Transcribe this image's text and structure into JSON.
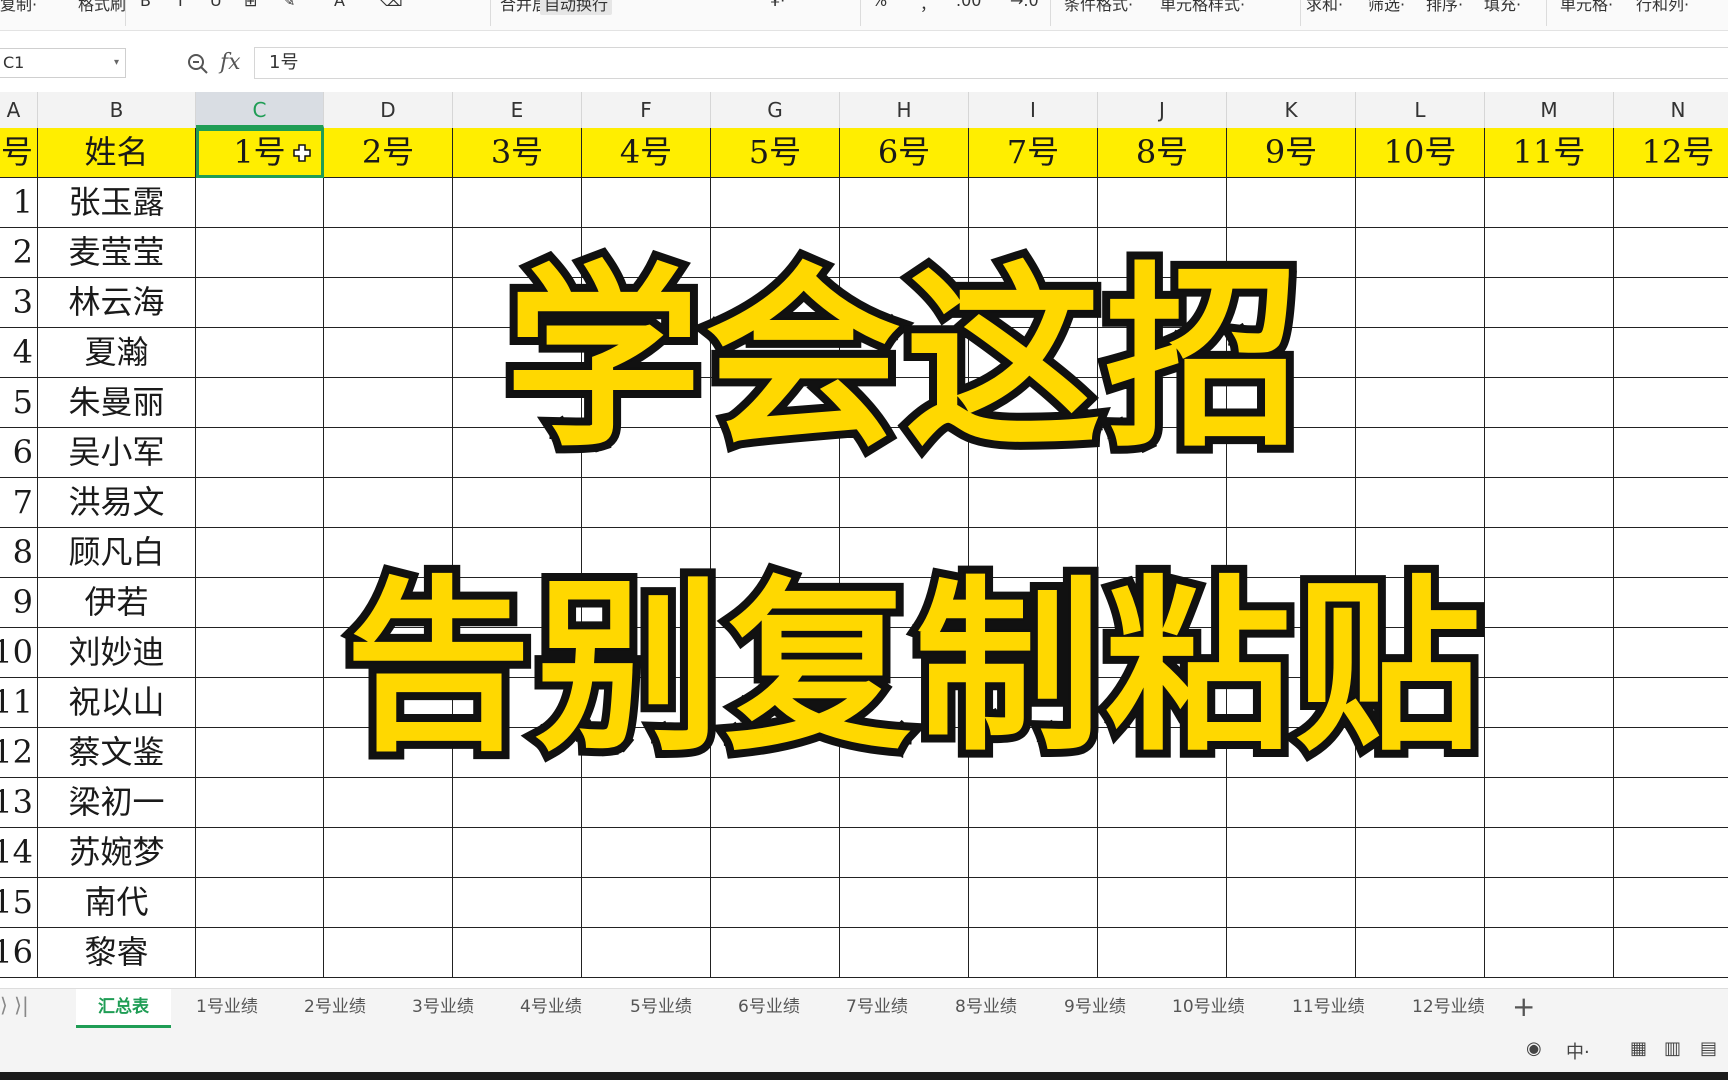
{
  "ribbon": {
    "items": [
      "复制·",
      "格式刷",
      "B",
      "I",
      "U",
      "⊞",
      "✎",
      "A",
      "⌫",
      "合并居中·",
      "自动换行",
      "¥·",
      "%",
      "，",
      ".00",
      "→.0",
      "条件格式·",
      "单元格样式·",
      "求和·",
      "筛选·",
      "排序·",
      "填充·",
      "单元格·",
      "行和列·"
    ]
  },
  "formula_bar": {
    "name_box": "C1",
    "fx_label": "fx",
    "formula_value": "1号"
  },
  "columns": [
    "A",
    "B",
    "C",
    "D",
    "E",
    "F",
    "G",
    "H",
    "I",
    "J",
    "K",
    "L",
    "M",
    "N"
  ],
  "selected_column": "C",
  "header_row": [
    "号",
    "姓名",
    "1号",
    "2号",
    "3号",
    "4号",
    "5号",
    "6号",
    "7号",
    "8号",
    "9号",
    "10号",
    "11号",
    "12号"
  ],
  "rows": [
    {
      "num": "1",
      "name": "张玉露"
    },
    {
      "num": "2",
      "name": "麦莹莹"
    },
    {
      "num": "3",
      "name": "林云海"
    },
    {
      "num": "4",
      "name": "夏瀚"
    },
    {
      "num": "5",
      "name": "朱曼丽"
    },
    {
      "num": "6",
      "name": "吴小军"
    },
    {
      "num": "7",
      "name": "洪易文"
    },
    {
      "num": "8",
      "name": "顾凡白"
    },
    {
      "num": "9",
      "name": "伊若"
    },
    {
      "num": "10",
      "name": "刘妙迪"
    },
    {
      "num": "11",
      "name": "祝以山"
    },
    {
      "num": "12",
      "name": "蔡文鉴"
    },
    {
      "num": "13",
      "name": "梁初一"
    },
    {
      "num": "14",
      "name": "苏婉梦"
    },
    {
      "num": "15",
      "name": "南代"
    },
    {
      "num": "16",
      "name": "黎睿"
    }
  ],
  "overlay": {
    "line1": "学会这招",
    "line2": "告别复制粘贴"
  },
  "sheet_tabs": {
    "nav": "⟩  ⟩|",
    "items": [
      "汇总表",
      "1号业绩",
      "2号业绩",
      "3号业绩",
      "4号业绩",
      "5号业绩",
      "6号业绩",
      "7号业绩",
      "8号业绩",
      "9号业绩",
      "10号业绩",
      "11号业绩",
      "12号业绩"
    ],
    "active": "汇总表",
    "add": "+"
  },
  "status_bar": {
    "items": [
      "◉",
      "中·",
      "▦",
      "▥",
      "▤"
    ]
  },
  "colors": {
    "header_fill": "#ffee00",
    "selection": "#1f9d55",
    "banner_fill": "#ffd800",
    "banner_stroke": "#111111"
  }
}
